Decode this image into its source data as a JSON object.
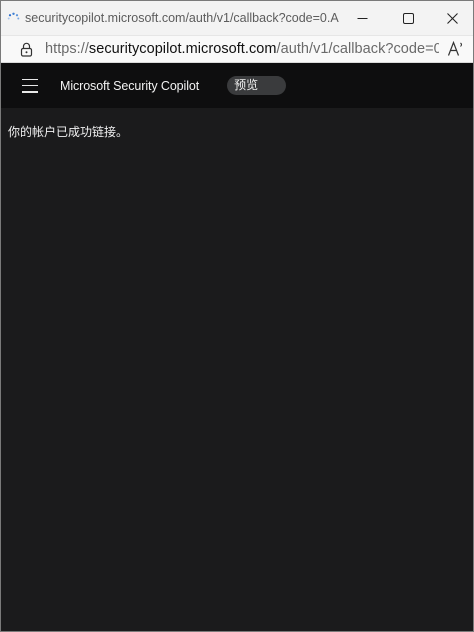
{
  "window": {
    "title": "securitycopilot.microsoft.com/auth/v1/callback?code=0.ARoA..."
  },
  "address_bar": {
    "scheme": "https://",
    "host": "securitycopilot.microsoft.com",
    "path": "/auth/v1/callback?code=0...",
    "read_aloud_label": "Aʼ"
  },
  "app_header": {
    "title": "Microsoft Security Copilot",
    "badge": "预览"
  },
  "main": {
    "message": "你的帐户已成功链接。"
  },
  "icons": {
    "loading": "loading-spinner-icon",
    "lock": "lock-icon",
    "minimize": "minimize-icon",
    "maximize": "maximize-icon",
    "close": "close-icon",
    "menu": "hamburger-menu-icon"
  },
  "colors": {
    "header_bg": "#0e0e0f",
    "content_bg": "#1b1b1c",
    "badge_bg": "#3a3b3d"
  }
}
